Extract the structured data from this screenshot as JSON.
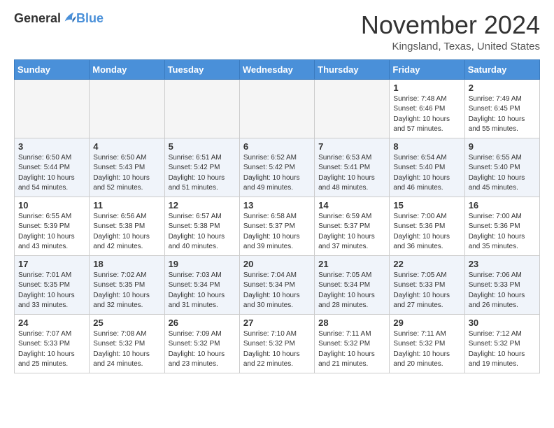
{
  "logo": {
    "general": "General",
    "blue": "Blue"
  },
  "header": {
    "month": "November 2024",
    "location": "Kingsland, Texas, United States"
  },
  "weekdays": [
    "Sunday",
    "Monday",
    "Tuesday",
    "Wednesday",
    "Thursday",
    "Friday",
    "Saturday"
  ],
  "weeks": [
    [
      {
        "day": "",
        "info": ""
      },
      {
        "day": "",
        "info": ""
      },
      {
        "day": "",
        "info": ""
      },
      {
        "day": "",
        "info": ""
      },
      {
        "day": "",
        "info": ""
      },
      {
        "day": "1",
        "info": "Sunrise: 7:48 AM\nSunset: 6:46 PM\nDaylight: 10 hours\nand 57 minutes."
      },
      {
        "day": "2",
        "info": "Sunrise: 7:49 AM\nSunset: 6:45 PM\nDaylight: 10 hours\nand 55 minutes."
      }
    ],
    [
      {
        "day": "3",
        "info": "Sunrise: 6:50 AM\nSunset: 5:44 PM\nDaylight: 10 hours\nand 54 minutes."
      },
      {
        "day": "4",
        "info": "Sunrise: 6:50 AM\nSunset: 5:43 PM\nDaylight: 10 hours\nand 52 minutes."
      },
      {
        "day": "5",
        "info": "Sunrise: 6:51 AM\nSunset: 5:42 PM\nDaylight: 10 hours\nand 51 minutes."
      },
      {
        "day": "6",
        "info": "Sunrise: 6:52 AM\nSunset: 5:42 PM\nDaylight: 10 hours\nand 49 minutes."
      },
      {
        "day": "7",
        "info": "Sunrise: 6:53 AM\nSunset: 5:41 PM\nDaylight: 10 hours\nand 48 minutes."
      },
      {
        "day": "8",
        "info": "Sunrise: 6:54 AM\nSunset: 5:40 PM\nDaylight: 10 hours\nand 46 minutes."
      },
      {
        "day": "9",
        "info": "Sunrise: 6:55 AM\nSunset: 5:40 PM\nDaylight: 10 hours\nand 45 minutes."
      }
    ],
    [
      {
        "day": "10",
        "info": "Sunrise: 6:55 AM\nSunset: 5:39 PM\nDaylight: 10 hours\nand 43 minutes."
      },
      {
        "day": "11",
        "info": "Sunrise: 6:56 AM\nSunset: 5:38 PM\nDaylight: 10 hours\nand 42 minutes."
      },
      {
        "day": "12",
        "info": "Sunrise: 6:57 AM\nSunset: 5:38 PM\nDaylight: 10 hours\nand 40 minutes."
      },
      {
        "day": "13",
        "info": "Sunrise: 6:58 AM\nSunset: 5:37 PM\nDaylight: 10 hours\nand 39 minutes."
      },
      {
        "day": "14",
        "info": "Sunrise: 6:59 AM\nSunset: 5:37 PM\nDaylight: 10 hours\nand 37 minutes."
      },
      {
        "day": "15",
        "info": "Sunrise: 7:00 AM\nSunset: 5:36 PM\nDaylight: 10 hours\nand 36 minutes."
      },
      {
        "day": "16",
        "info": "Sunrise: 7:00 AM\nSunset: 5:36 PM\nDaylight: 10 hours\nand 35 minutes."
      }
    ],
    [
      {
        "day": "17",
        "info": "Sunrise: 7:01 AM\nSunset: 5:35 PM\nDaylight: 10 hours\nand 33 minutes."
      },
      {
        "day": "18",
        "info": "Sunrise: 7:02 AM\nSunset: 5:35 PM\nDaylight: 10 hours\nand 32 minutes."
      },
      {
        "day": "19",
        "info": "Sunrise: 7:03 AM\nSunset: 5:34 PM\nDaylight: 10 hours\nand 31 minutes."
      },
      {
        "day": "20",
        "info": "Sunrise: 7:04 AM\nSunset: 5:34 PM\nDaylight: 10 hours\nand 30 minutes."
      },
      {
        "day": "21",
        "info": "Sunrise: 7:05 AM\nSunset: 5:34 PM\nDaylight: 10 hours\nand 28 minutes."
      },
      {
        "day": "22",
        "info": "Sunrise: 7:05 AM\nSunset: 5:33 PM\nDaylight: 10 hours\nand 27 minutes."
      },
      {
        "day": "23",
        "info": "Sunrise: 7:06 AM\nSunset: 5:33 PM\nDaylight: 10 hours\nand 26 minutes."
      }
    ],
    [
      {
        "day": "24",
        "info": "Sunrise: 7:07 AM\nSunset: 5:33 PM\nDaylight: 10 hours\nand 25 minutes."
      },
      {
        "day": "25",
        "info": "Sunrise: 7:08 AM\nSunset: 5:32 PM\nDaylight: 10 hours\nand 24 minutes."
      },
      {
        "day": "26",
        "info": "Sunrise: 7:09 AM\nSunset: 5:32 PM\nDaylight: 10 hours\nand 23 minutes."
      },
      {
        "day": "27",
        "info": "Sunrise: 7:10 AM\nSunset: 5:32 PM\nDaylight: 10 hours\nand 22 minutes."
      },
      {
        "day": "28",
        "info": "Sunrise: 7:11 AM\nSunset: 5:32 PM\nDaylight: 10 hours\nand 21 minutes."
      },
      {
        "day": "29",
        "info": "Sunrise: 7:11 AM\nSunset: 5:32 PM\nDaylight: 10 hours\nand 20 minutes."
      },
      {
        "day": "30",
        "info": "Sunrise: 7:12 AM\nSunset: 5:32 PM\nDaylight: 10 hours\nand 19 minutes."
      }
    ]
  ]
}
